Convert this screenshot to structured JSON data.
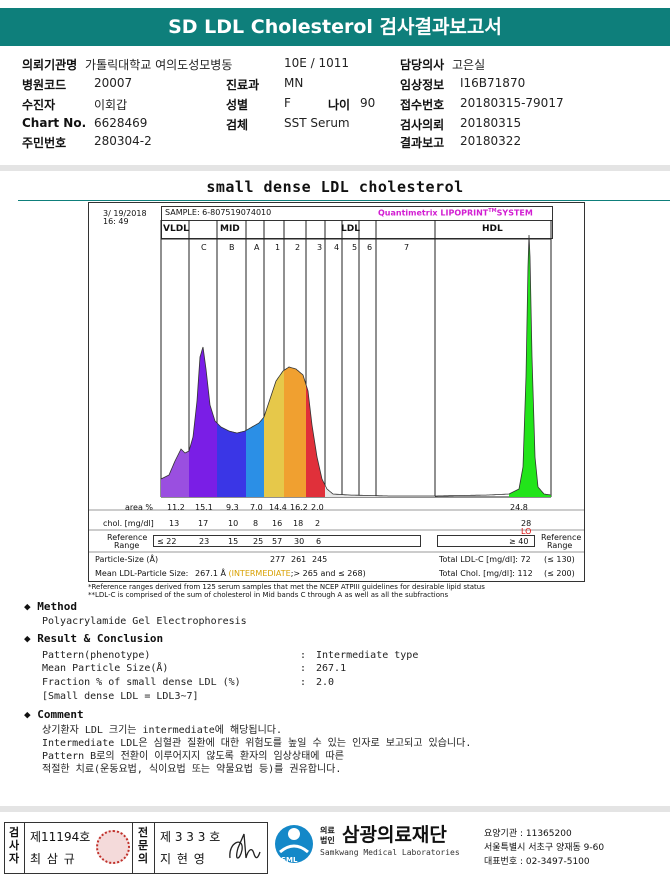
{
  "header": {
    "title": "SD LDL Cholesterol 검사결과보고서"
  },
  "info": {
    "hospital_label": "의뢰기관명",
    "hospital_value": "가톨릭대학교 여의도성모병동",
    "ward_value": "10E / 1011",
    "doctor_label": "담당의사",
    "doctor_value": "고은실",
    "code_label": "병원코드",
    "code_value": "20007",
    "dept_label": "진료과",
    "dept_value": "MN",
    "clinical_label": "임상정보",
    "clinical_value": "I16B71870",
    "patient_label": "수진자",
    "patient_value": "이회갑",
    "sex_label": "성별",
    "sex_value": "F",
    "age_label": "나이",
    "age_value": "90",
    "receipt_label": "접수번호",
    "receipt_value": "20180315-79017",
    "chart_label": "Chart No.",
    "chart_value": "6628469",
    "test_label": "검체",
    "test_value": "SST Serum",
    "request_label": "검사의뢰",
    "request_value": "20180315",
    "id_label": "주민번호",
    "id_value": "280304-2",
    "report_label": "결과보고",
    "report_value": "20180322"
  },
  "section_title": "small dense LDL cholesterol",
  "chart": {
    "date": "3/ 19/2018",
    "time": "16: 49",
    "sample": "SAMPLE:   6-807519074010",
    "brand": "Quantimetrix LIPOPRINT",
    "brand_tm": "TM",
    "brand_suffix": "SYSTEM",
    "groups": [
      "VLDL",
      "MID",
      "LDL",
      "HDL"
    ],
    "subbands": [
      "C",
      "B",
      "A",
      "1",
      "2",
      "3",
      "4",
      "5",
      "6",
      "7"
    ],
    "rows": {
      "area_label": "area %",
      "area": [
        "11.2",
        "15.1",
        "9.3",
        "7.0",
        "14.4",
        "16.2",
        "2.0",
        "24.8"
      ],
      "chol_label": "chol. [mg/dl]",
      "chol": [
        "13",
        "17",
        "10",
        "8",
        "16",
        "18",
        "2",
        "28"
      ],
      "chol_flag": "LO",
      "ref_label_1": "Reference",
      "ref_label_2": "Range",
      "ref": [
        "≤ 22",
        "23",
        "15",
        "25",
        "57",
        "30",
        "6",
        "≥ 40"
      ],
      "ref_right_1": "Reference",
      "ref_right_2": "Range",
      "particle_label": "Particle-Size (Å)",
      "particle": [
        "277",
        "261",
        "245"
      ],
      "mean_label": "Mean LDL-Particle Size:",
      "mean_value": "267.1 Å",
      "mean_cat": "(INTERMEDIATE",
      "mean_range": ";> 265 and ≤ 268)",
      "total_ldl_label": "Total LDL-C [mg/dl]:",
      "total_ldl_value": "72",
      "total_ldl_ref": "(≤ 130)",
      "total_chol_label": "Total Chol. [mg/dl]:",
      "total_chol_value": "112",
      "total_chol_ref": "(≤ 200)"
    }
  },
  "chart_data": {
    "type": "area",
    "title": "",
    "xlabel": "",
    "ylabel": "",
    "categories": [
      "VLDL",
      "MID C",
      "MID B",
      "MID A",
      "LDL 1",
      "LDL 2",
      "LDL 3-7",
      "HDL"
    ],
    "series": [
      {
        "name": "area %",
        "values": [
          11.2,
          15.1,
          9.3,
          7.0,
          14.4,
          16.2,
          2.0,
          24.8
        ]
      },
      {
        "name": "chol. [mg/dl]",
        "values": [
          13,
          17,
          10,
          8,
          16,
          18,
          2,
          28
        ]
      }
    ],
    "colors": {
      "vldl": "#9a4fe0",
      "mid": "#7a1ee6",
      "mid_b": "#3a36e6",
      "mid_a": "#2b8fe6",
      "ldl1": "#e6c84a",
      "ldl2": "#f0a030",
      "ldl3": "#e0303a",
      "hdl": "#22e41a"
    }
  },
  "notes": {
    "n1": "*Reference ranges derived from 125 serum samples that met the NCEP ATPIII guidelines for desirable lipid status",
    "n2": "**LDL-C is comprised of the sum of cholesterol in Mid bands C through A as well as all the subfractions"
  },
  "method": {
    "heading": "Method",
    "text": "Polyacrylamide Gel Electrophoresis"
  },
  "result": {
    "heading": "Result & Conclusion",
    "rows": [
      {
        "label": "Pattern(phenotype)",
        "value": "Intermediate type"
      },
      {
        "label": "Mean Particle Size(Å)",
        "value": "267.1"
      },
      {
        "label": "Fraction % of small dense LDL (%)",
        "value": "2.0"
      }
    ],
    "colon": ":",
    "footnote": "[Small dense LDL = LDL3~7]"
  },
  "comment": {
    "heading": "Comment",
    "lines": [
      "상기환자 LDL 크기는 intermediate에 해당됩니다.",
      "Intermediate LDL은 심혈관 질환에 대한 위험도를 높일 수 있는 인자로 보고되고 있습니다.",
      "Pattern B로의 전환이 이루어지지 않도록 환자의 임상상태에 따른",
      "적절한 치료(운동요법, 식이요법 또는 약물요법 등)를 권유합니다."
    ]
  },
  "footer": {
    "tester_label": "검사자",
    "tester_no": "제11194호",
    "tester_name": "최 삼 규",
    "specialist_label": "전문의",
    "specialist_no": "제 3 3 3 호",
    "specialist_name": "지 현 영",
    "org_prefix_1": "의료",
    "org_prefix_2": "법인",
    "org_name": "삼광의료재단",
    "org_en": "Samkwang Medical Laboratories",
    "logo_text": "SML",
    "org_code": "요양기관 : 11365200",
    "org_addr": "서울특별시 서초구 양재동 9-60",
    "org_tel": "대표번호 : 02-3497-5100"
  }
}
